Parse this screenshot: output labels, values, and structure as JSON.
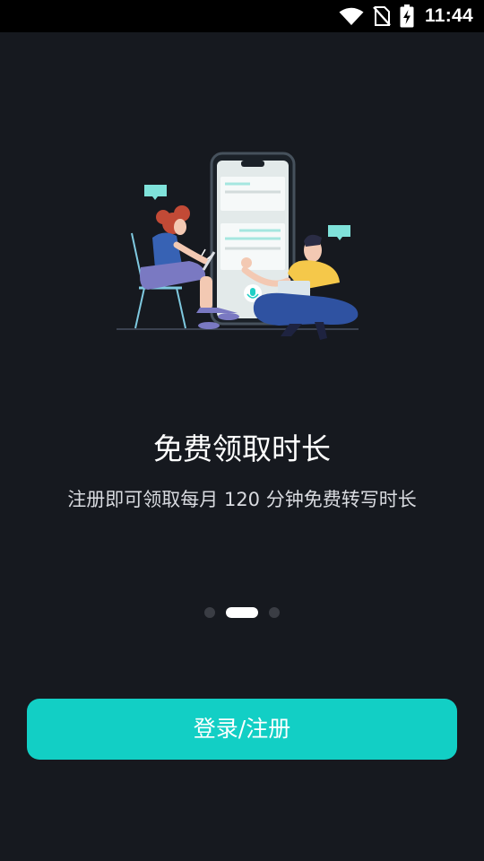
{
  "status_bar": {
    "time": "11:44",
    "icons": [
      "wifi-icon",
      "no-sim-icon",
      "battery-charging-icon"
    ]
  },
  "onboarding": {
    "title": "免费领取时长",
    "subtitle": "注册即可领取每月 120 分钟免费转写时长",
    "pager": {
      "page_count": 3,
      "current_page": 2
    }
  },
  "actions": {
    "login_label": "登录/注册"
  },
  "colors": {
    "background": "#16191f",
    "accent": "#12cfc5",
    "status_bar": "#000000"
  }
}
